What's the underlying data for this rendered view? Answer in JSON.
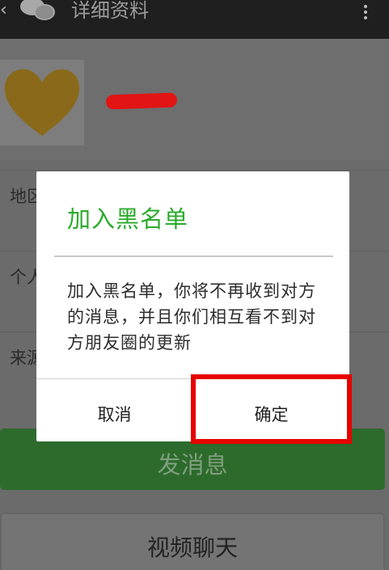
{
  "header": {
    "back_icon": "chevron-left-icon",
    "app_icon": "wechat-icon",
    "title": "详细资料",
    "more_icon": "more-vertical-icon"
  },
  "profile": {
    "avatar_icon": "heart-icon",
    "name_redacted": true
  },
  "rows": {
    "region_label": "地区",
    "signature_label": "个人签名",
    "source_label": "来源"
  },
  "actions": {
    "send_message_label": "发消息",
    "video_chat_label": "视频聊天"
  },
  "dialog": {
    "title": "加入黑名单",
    "message": "加入黑名单，你将不再收到对方的消息，并且你们相互看不到对方朋友圈的更新",
    "cancel_label": "取消",
    "confirm_label": "确定"
  },
  "colors": {
    "accent_green": "#2bab2b",
    "highlight_red": "#e60000"
  }
}
